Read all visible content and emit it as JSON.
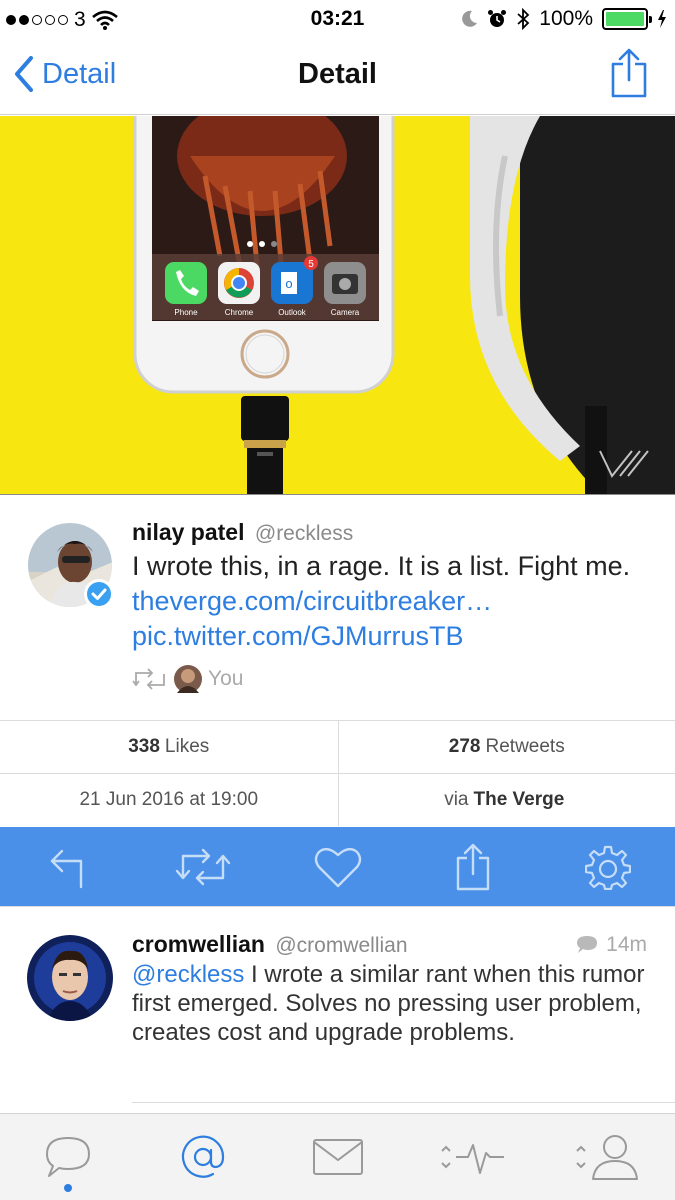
{
  "status_bar": {
    "carrier": "3",
    "time": "03:21",
    "battery_percent": "100%",
    "battery_level": 1.0,
    "signal_bars_filled": 2,
    "signal_bars_total": 5
  },
  "nav": {
    "back_label": "Detail",
    "title": "Detail"
  },
  "tweet": {
    "author_name": "nilay patel",
    "author_handle": "@reckless",
    "text_plain": "I wrote this, in a rage. It is a list. Fight me.",
    "link_article": "theverge.com/circuitbreaker…",
    "link_pic": "pic.twitter.com/GJMurrusTB",
    "retweeted_by": "You",
    "verified": true
  },
  "hero_image": {
    "apps": [
      "Phone",
      "Chrome",
      "Outlook",
      "Camera"
    ],
    "outlook_badge": "5"
  },
  "stats": {
    "likes_count": "338",
    "likes_label": "Likes",
    "retweets_count": "278",
    "retweets_label": "Retweets",
    "date": "21 Jun 2016 at 19:00",
    "via_prefix": "via",
    "via_source": "The Verge"
  },
  "actions": [
    "reply",
    "retweet",
    "like",
    "share",
    "settings"
  ],
  "reply": {
    "author_name": "cromwellian",
    "author_handle": "@cromwellian",
    "time": "14m",
    "mention": "@reckless",
    "text": " I wrote a similar rant when this rumor first emerged. Solves no pressing user problem, creates cost and upgrade problems."
  },
  "tabs": [
    "timeline",
    "mentions",
    "messages",
    "activity",
    "profile"
  ],
  "colors": {
    "accent": "#2d7ee0",
    "action_bar": "#4a90e8",
    "hero_background": "#f7e60f",
    "battery": "#4cd964"
  }
}
